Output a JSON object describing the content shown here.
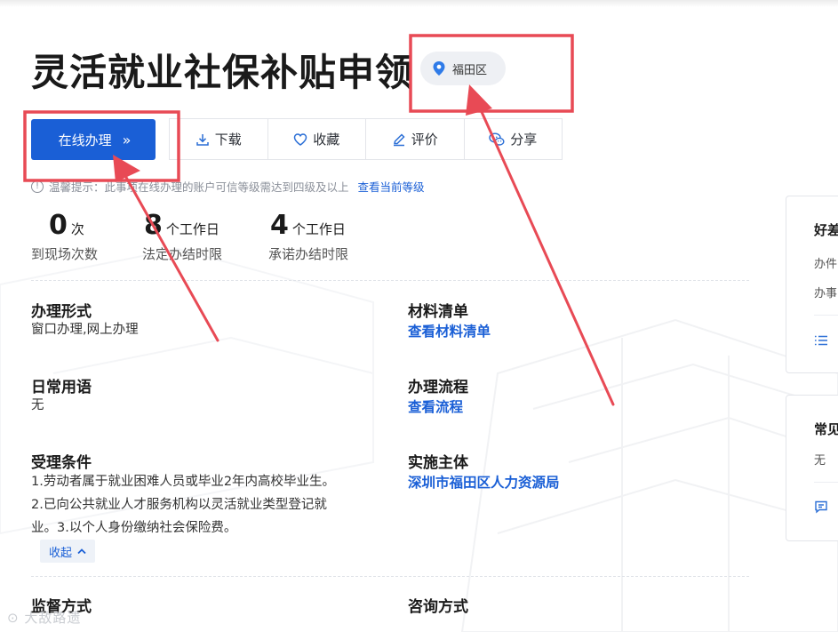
{
  "page": {
    "title": "灵活就业社保补贴申领",
    "region": "福田区"
  },
  "actions": {
    "online": "在线办理",
    "online_chevron": "»",
    "download": "下载",
    "favorite": "收藏",
    "rate": "评价",
    "share": "分享"
  },
  "tip": {
    "text": "温馨提示：此事项在线办理的账户可信等级需达到四级及以上",
    "link": "查看当前等级"
  },
  "stats": [
    {
      "num": "0",
      "unit": "次",
      "label": "到现场次数"
    },
    {
      "num": "8",
      "unit": "个工作日",
      "label": "法定办结时限"
    },
    {
      "num": "4",
      "unit": "个工作日",
      "label": "承诺办结时限"
    }
  ],
  "fields": {
    "method": {
      "title": "办理形式",
      "value": "窗口办理,网上办理"
    },
    "materials": {
      "title": "材料清单",
      "link": "查看材料清单"
    },
    "terms": {
      "title": "日常用语",
      "value": "无"
    },
    "process": {
      "title": "办理流程",
      "link": "查看流程"
    },
    "conditions": {
      "title": "受理条件",
      "lines": [
        "1.劳动者属于就业困难人员或毕业2年内高校毕业生。",
        "2.已向公共就业人才服务机构以灵活就业类型登记就",
        "业。3.以个人身份缴纳社会保险费。"
      ],
      "collapse": "收起"
    },
    "authority": {
      "title": "实施主体",
      "link": "深圳市福田区人力资源局"
    },
    "supervision": {
      "title": "监督方式"
    },
    "consult": {
      "title": "咨询方式"
    }
  },
  "side": {
    "card1": {
      "title": "好差",
      "line1": "办件",
      "line2": "办事"
    },
    "card2": {
      "title": "常见",
      "line1": "无"
    }
  },
  "watermark": "⊙ 大敌路遗",
  "colors": {
    "primary": "#1a5fd6",
    "annotation": "#e84a55"
  }
}
